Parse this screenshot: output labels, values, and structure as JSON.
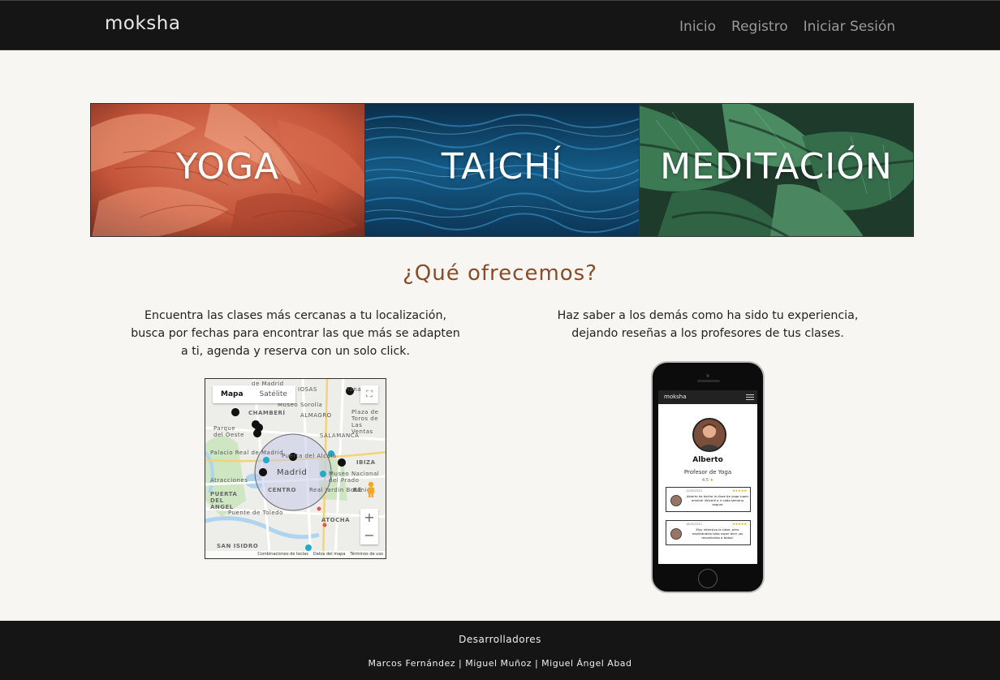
{
  "navbar": {
    "brand": "moksha",
    "links": [
      "Inicio",
      "Registro",
      "Iniciar Sesión"
    ]
  },
  "hero": {
    "tiles": [
      {
        "label": "YOGA",
        "image": "coral-mushroom-gills"
      },
      {
        "label": "TAICHÍ",
        "image": "blue-ocean-water"
      },
      {
        "label": "MEDITACIÓN",
        "image": "green-monstera-leaves"
      }
    ]
  },
  "offer": {
    "title": "¿Qué ofrecemos?",
    "left_text": "Encuentra las clases más cercanas a tu localización, busca por fechas para encontrar las que más se adapten a ti, agenda y reserva con un solo click.",
    "right_text": "Haz saber a los demás como ha sido tu experiencia, dejando reseñas a los profesores de tus clases."
  },
  "map": {
    "tabs": [
      "Mapa",
      "Satélite"
    ],
    "labels": {
      "chamberi": "CHAMBERÍ",
      "almagro": "ALMAGRO",
      "salamanca": "SALAMANCA",
      "madrid": "Madrid",
      "centro": "CENTRO",
      "sorolla": "Museo Sorolla",
      "palacio": "Palacio Real de Madrid",
      "puerta_sol": "Puerta del Alcalá",
      "prado": "Museo Nacional del Prado",
      "jardin": "Real Jardín Botánico",
      "atocha": "ATOCHA",
      "ibiza": "IBIZA",
      "toledo": "Puente de Toledo",
      "angel": "PUERTA DEL ÁNGEL",
      "isidro": "SAN ISIDRO",
      "demadrid": "de Madrid",
      "iosas": "IOSAS",
      "plaza_toros": "Plaza de Toros de Las Ventas",
      "parque_oeste": "Parque del Oeste",
      "atracciones": "Atracciones",
      "re": "RE",
      "tana": "Tana"
    },
    "footer": [
      "Combinaciones de teclas",
      "Datos del mapa",
      "Términos de uso"
    ],
    "zoom_in": "+",
    "zoom_out": "−",
    "fullscreen": "⛶"
  },
  "phone": {
    "app_brand": "moksha",
    "name": "Alberto",
    "role": "Profesor de Yoga",
    "rating": "4.5",
    "rating_star": "★",
    "reviews": [
      {
        "date": "12/05/2021",
        "stars": "★★★★★",
        "text": "Alberto ha hecho la clase de yoga super amena! Volveré a ir cada semana seguro"
      },
      {
        "date": "18/05/2021",
        "stars": "★★★★★",
        "text": "Muy intensivo la clase, pero explicándolo todo super bien ¡os recomiendo a todos!"
      }
    ]
  },
  "footer": {
    "title": "Desarrolladores",
    "names": "Marcos Fernández | Miguel Muñoz | Miguel Ángel Abad"
  },
  "colors": {
    "navbar_bg": "#151515",
    "page_bg": "#f8f6f2",
    "accent": "#8a4b28"
  }
}
